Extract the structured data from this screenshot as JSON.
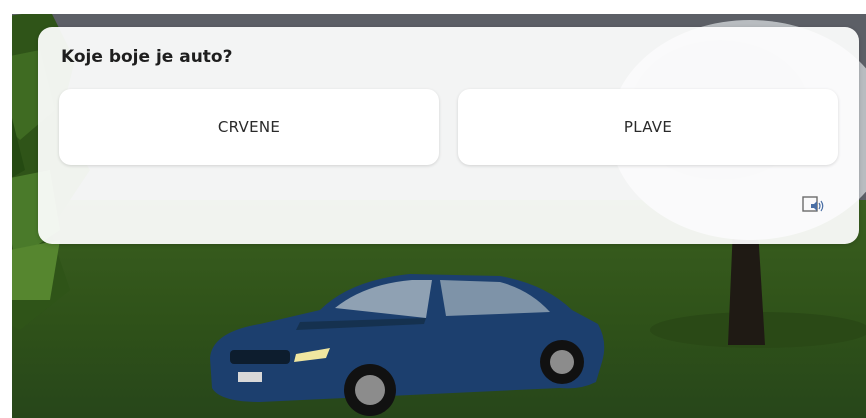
{
  "quiz": {
    "question": "Koje boje je auto?",
    "answers": [
      {
        "label": "CRVENE"
      },
      {
        "label": "PLAVE"
      }
    ],
    "audio_icon": "speaker-icon"
  },
  "scene": {
    "car_color": "#1c3f6e",
    "grass_color": "#335a1c",
    "sky_color": "#5c5f66"
  }
}
